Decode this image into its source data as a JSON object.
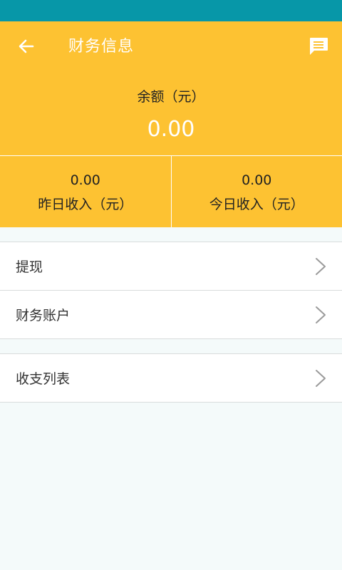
{
  "header": {
    "title": "财务信息",
    "back_icon": "arrow-left-icon",
    "message_icon": "message-icon"
  },
  "balance": {
    "label": "余额（元）",
    "value": "0.00"
  },
  "income": {
    "yesterday": {
      "value": "0.00",
      "label": "昨日收入（元）"
    },
    "today": {
      "value": "0.00",
      "label": "今日收入（元）"
    }
  },
  "menu": {
    "withdraw": "提现",
    "account": "财务账户",
    "records": "收支列表"
  },
  "colors": {
    "status_bar": "#0797a8",
    "header_bg": "#fdc232",
    "page_bg": "#f4fafa"
  }
}
